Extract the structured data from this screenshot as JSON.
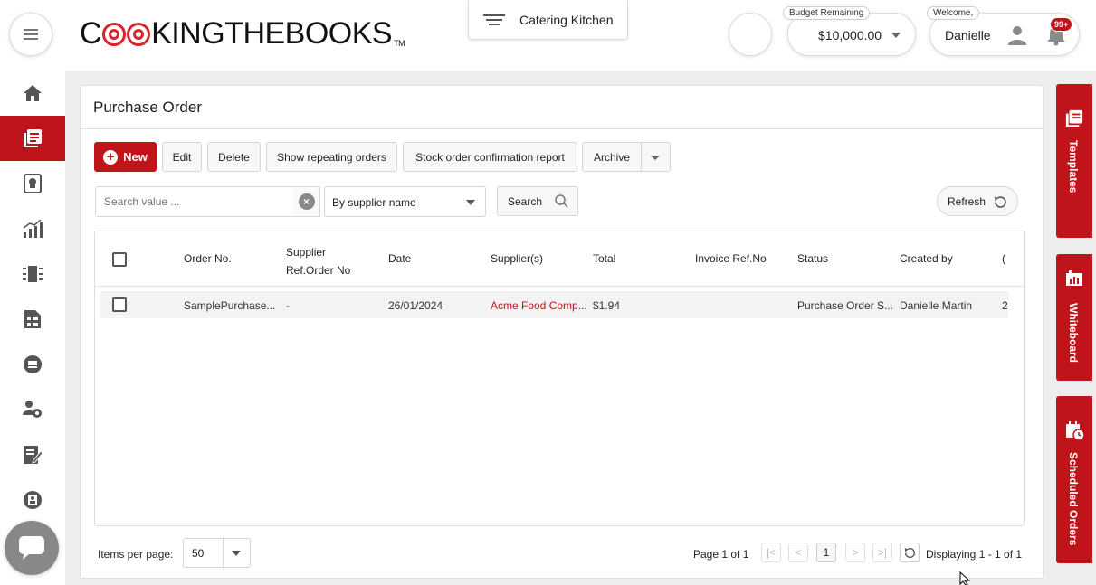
{
  "header": {
    "logo": {
      "pre": "C",
      "post": "KINGTHEBOOKS",
      "tm": "TM"
    },
    "kitchen": "Catering Kitchen",
    "budget": {
      "tag": "Budget Remaining",
      "value": "$10,000.00"
    },
    "welcome": {
      "tag": "Welcome,",
      "name": "Danielle",
      "badge": "99+"
    }
  },
  "panel": {
    "title": "Purchase Order"
  },
  "toolbar": {
    "new": "New",
    "edit": "Edit",
    "delete": "Delete",
    "repeating": "Show repeating orders",
    "stock_report": "Stock order confirmation report",
    "archive": "Archive"
  },
  "search": {
    "placeholder": "Search value ...",
    "filter": "By supplier name",
    "button": "Search",
    "refresh": "Refresh"
  },
  "table": {
    "columns": [
      "Order No.",
      "Supplier Ref.Order No",
      "Date",
      "Supplier(s)",
      "Total",
      "Invoice Ref.No",
      "Status",
      "Created by",
      "("
    ],
    "rows": [
      [
        "SamplePurchase...",
        "-",
        "26/01/2024",
        "Acme Food Comp...",
        "$1.94",
        "",
        "Purchase Order S...",
        "Danielle Martin",
        "2"
      ]
    ]
  },
  "footer": {
    "items_label": "Items per page:",
    "items_value": "50",
    "page_info": "Page 1 of 1",
    "current_page": "1",
    "displaying": "Displaying 1 - 1 of 1"
  },
  "right_tabs": [
    "Templates",
    "Whiteboard",
    "Scheduled Orders"
  ],
  "colors": {
    "accent": "#c0141b"
  }
}
